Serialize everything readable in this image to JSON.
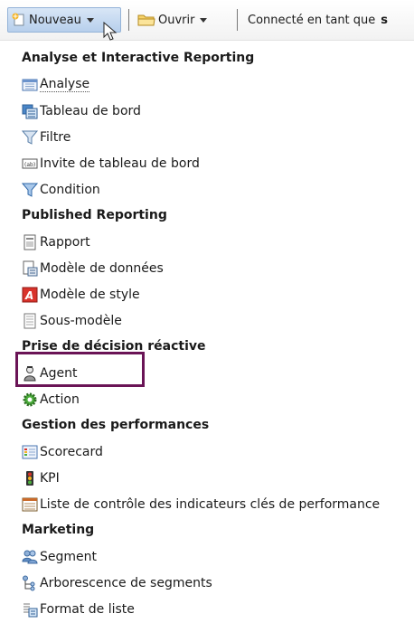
{
  "toolbar": {
    "new_label": "Nouveau",
    "open_label": "Ouvrir",
    "user_prefix": "Connecté en tant que",
    "user_name": "s"
  },
  "menu": {
    "sections": [
      {
        "title": "Analyse et Interactive Reporting",
        "items": [
          {
            "label": "Analyse",
            "icon": "analysis-icon"
          },
          {
            "label": "Tableau de bord",
            "icon": "dashboard-icon"
          },
          {
            "label": "Filtre",
            "icon": "filter-icon"
          },
          {
            "label": "Invite de tableau de bord",
            "icon": "prompt-icon"
          },
          {
            "label": "Condition",
            "icon": "condition-icon"
          }
        ]
      },
      {
        "title": "Published Reporting",
        "items": [
          {
            "label": "Rapport",
            "icon": "report-icon"
          },
          {
            "label": "Modèle de données",
            "icon": "data-model-icon"
          },
          {
            "label": "Modèle de style",
            "icon": "style-template-icon"
          },
          {
            "label": "Sous-modèle",
            "icon": "sub-template-icon"
          }
        ]
      },
      {
        "title": "Prise de décision réactive",
        "items": [
          {
            "label": "Agent",
            "icon": "agent-icon"
          },
          {
            "label": "Action",
            "icon": "action-icon"
          }
        ]
      },
      {
        "title": "Gestion des performances",
        "items": [
          {
            "label": "Scorecard",
            "icon": "scorecard-icon"
          },
          {
            "label": "KPI",
            "icon": "kpi-icon"
          },
          {
            "label": "Liste de contrôle des indicateurs clés de performance",
            "icon": "kpi-watchlist-icon"
          }
        ]
      },
      {
        "title": "Marketing",
        "items": [
          {
            "label": "Segment",
            "icon": "segment-icon"
          },
          {
            "label": "Arborescence de segments",
            "icon": "segment-tree-icon"
          },
          {
            "label": "Format de liste",
            "icon": "list-format-icon"
          }
        ]
      }
    ]
  },
  "colors": {
    "highlight": "#6a1456",
    "toolbar_active": "#b7cfec"
  }
}
